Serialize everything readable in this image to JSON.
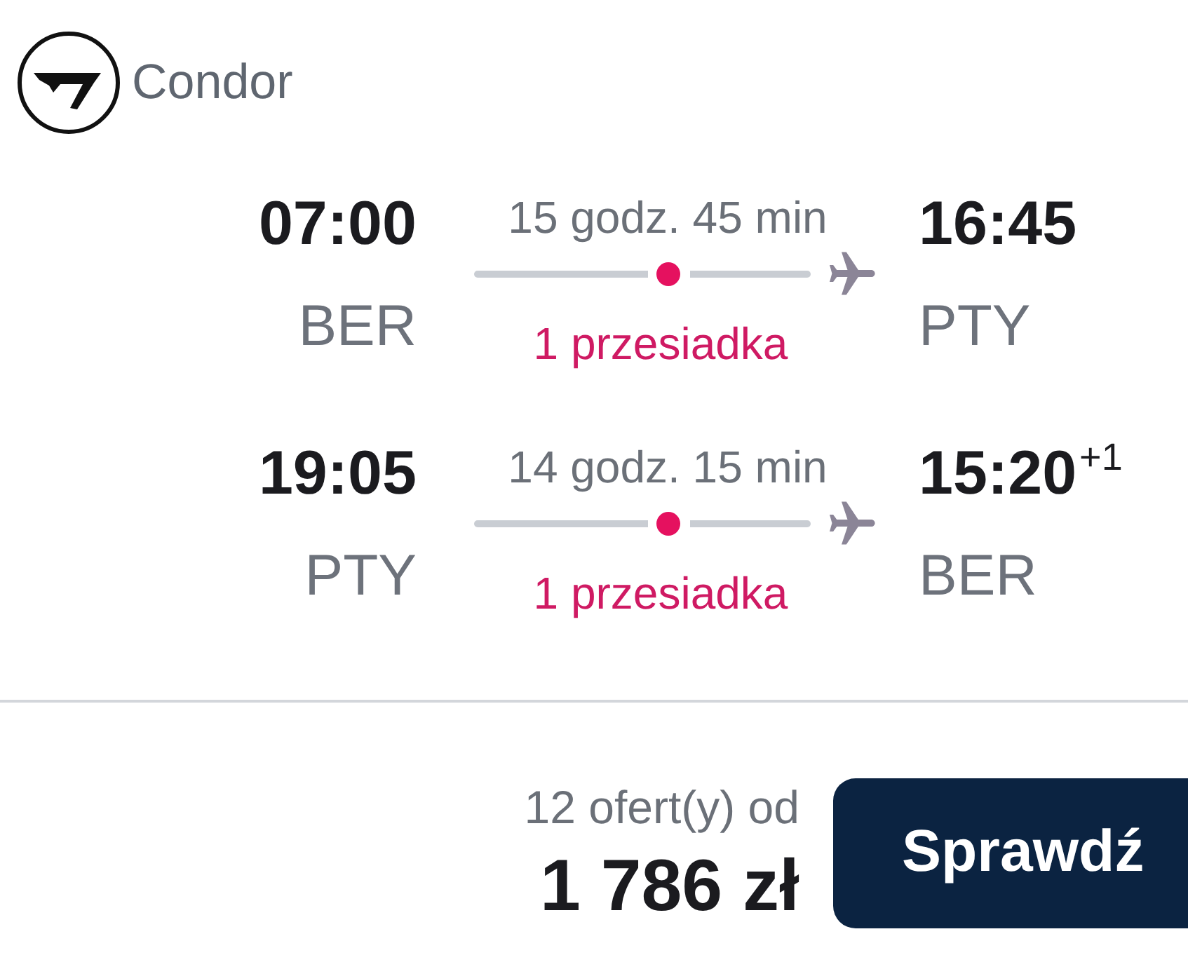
{
  "airline": {
    "name": "Condor"
  },
  "legs": [
    {
      "departure": {
        "time": "07:00",
        "airport": "BER"
      },
      "duration": "15 godz. 45 min",
      "stops": "1 przesiadka",
      "arrival": {
        "time": "16:45",
        "airport": "PTY"
      }
    },
    {
      "departure": {
        "time": "19:05",
        "airport": "PTY"
      },
      "duration": "14 godz. 15 min",
      "stops": "1 przesiadka",
      "arrival": {
        "time": "15:20",
        "day_offset": "+1",
        "airport": "BER"
      }
    }
  ],
  "offer": {
    "offers_text": "12 ofert(y) od",
    "price": "1 786 zł",
    "button": "Sprawdź"
  }
}
